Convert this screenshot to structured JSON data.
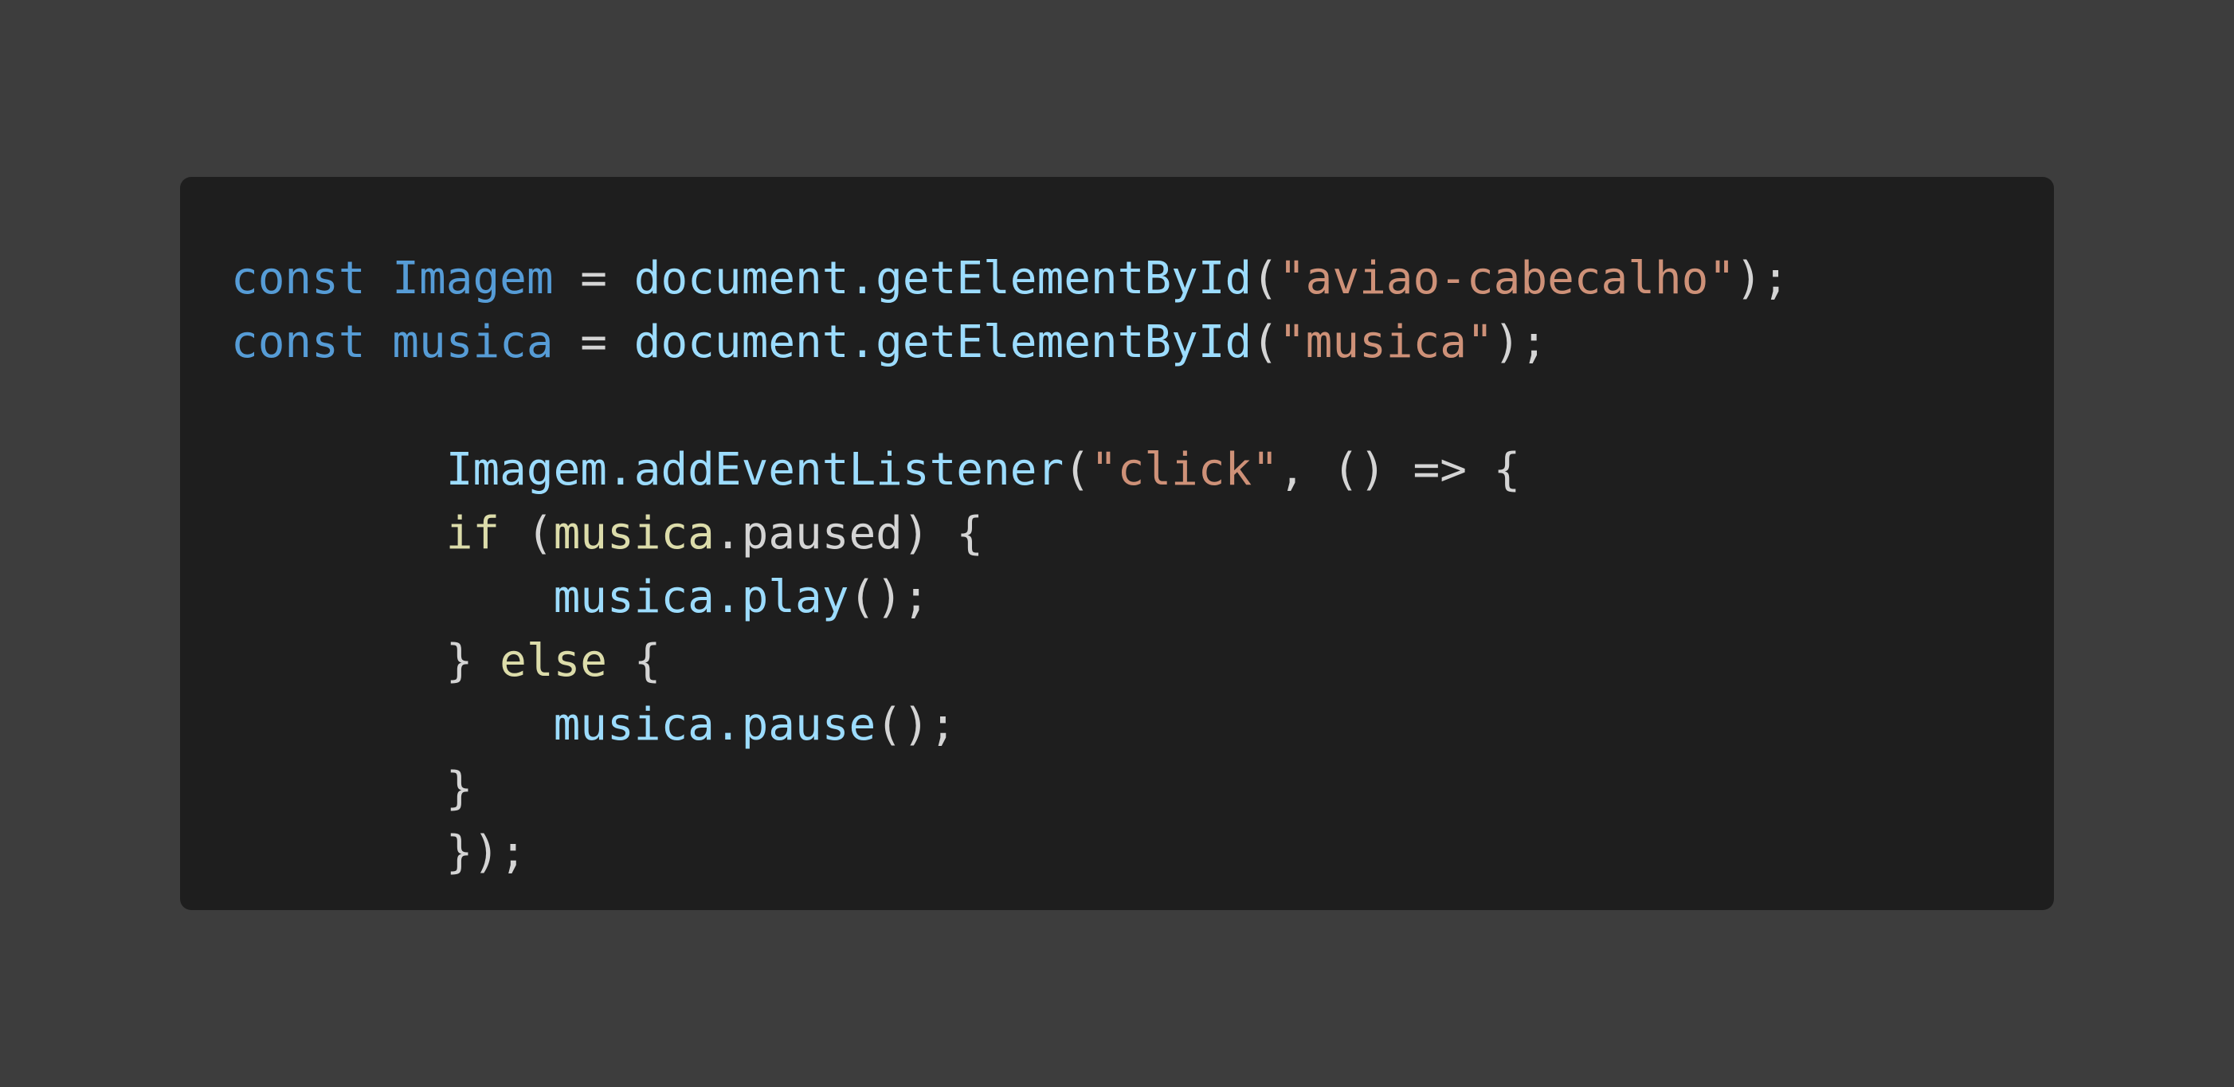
{
  "colors": {
    "background": "#3d3d3d",
    "panel": "#1e1e1e",
    "keyword": "#569cd6",
    "identifier": "#9cdcfe",
    "string": "#ce9178",
    "control": "#dcdcaa",
    "punctuation": "#d4d4d4"
  },
  "code": {
    "lines": [
      {
        "tokens": [
          {
            "text": "const",
            "type": "keyword"
          },
          {
            "text": " ",
            "type": "punctuation"
          },
          {
            "text": "Imagem",
            "type": "keyword"
          },
          {
            "text": " = ",
            "type": "punctuation"
          },
          {
            "text": "document.getElementById",
            "type": "identifier"
          },
          {
            "text": "(",
            "type": "punctuation"
          },
          {
            "text": "\"aviao-cabecalho\"",
            "type": "string"
          },
          {
            "text": ");",
            "type": "punctuation"
          }
        ]
      },
      {
        "tokens": [
          {
            "text": "const",
            "type": "keyword"
          },
          {
            "text": " ",
            "type": "punctuation"
          },
          {
            "text": "musica",
            "type": "keyword"
          },
          {
            "text": " = ",
            "type": "punctuation"
          },
          {
            "text": "document.getElementById",
            "type": "identifier"
          },
          {
            "text": "(",
            "type": "punctuation"
          },
          {
            "text": "\"musica\"",
            "type": "string"
          },
          {
            "text": ");",
            "type": "punctuation"
          }
        ]
      },
      {
        "tokens": []
      },
      {
        "tokens": [
          {
            "text": "        ",
            "type": "punctuation"
          },
          {
            "text": "Imagem.addEventListener",
            "type": "identifier"
          },
          {
            "text": "(",
            "type": "punctuation"
          },
          {
            "text": "\"click\"",
            "type": "string"
          },
          {
            "text": ", () => {",
            "type": "punctuation"
          }
        ]
      },
      {
        "tokens": [
          {
            "text": "        ",
            "type": "punctuation"
          },
          {
            "text": "if",
            "type": "control"
          },
          {
            "text": " (",
            "type": "punctuation"
          },
          {
            "text": "musica",
            "type": "control"
          },
          {
            "text": ".paused) {",
            "type": "punctuation"
          }
        ]
      },
      {
        "tokens": [
          {
            "text": "            ",
            "type": "punctuation"
          },
          {
            "text": "musica.play",
            "type": "identifier"
          },
          {
            "text": "();",
            "type": "punctuation"
          }
        ]
      },
      {
        "tokens": [
          {
            "text": "        } ",
            "type": "punctuation"
          },
          {
            "text": "else",
            "type": "control"
          },
          {
            "text": " {",
            "type": "punctuation"
          }
        ]
      },
      {
        "tokens": [
          {
            "text": "            ",
            "type": "punctuation"
          },
          {
            "text": "musica.pause",
            "type": "identifier"
          },
          {
            "text": "();",
            "type": "punctuation"
          }
        ]
      },
      {
        "tokens": [
          {
            "text": "        }",
            "type": "punctuation"
          }
        ]
      },
      {
        "tokens": [
          {
            "text": "        });",
            "type": "punctuation"
          }
        ]
      }
    ]
  }
}
